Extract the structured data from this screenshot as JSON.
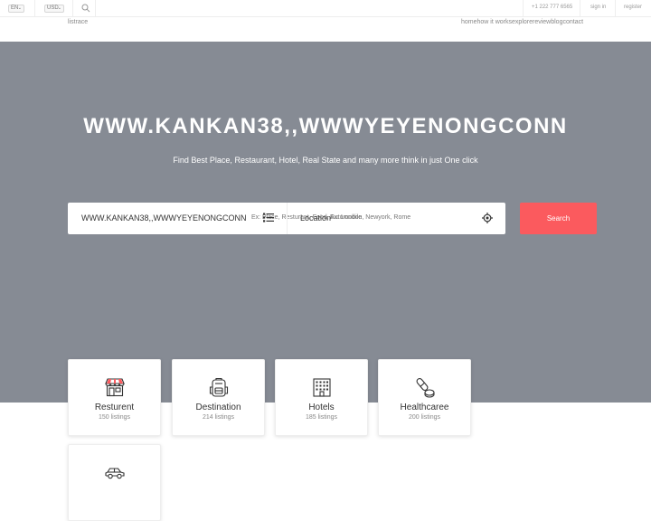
{
  "topbar": {
    "language": "EN",
    "currency": "USD",
    "phone": "+1 222 777 6565",
    "signin": "sign in",
    "register": "register"
  },
  "header": {
    "logo": "listrace",
    "nav": [
      "home",
      "how it works",
      "explore",
      "review",
      "blog",
      "contact"
    ]
  },
  "hero": {
    "title": "WWW.KANKAN38,,WWWYEYENONGCONN",
    "subtitle": "Find Best Place, Restaurant, Hotel, Real State and many more think in just One click"
  },
  "search": {
    "keyword_value": "WWW.KANKAN38,,WWWYEYENONGCONN",
    "keyword_placeholder": "Ex: Place, Resturant, Food, Automobile",
    "location_label": "Location",
    "location_placeholder": "Ex: London, Newyork, Rome",
    "button": "Search"
  },
  "categories": [
    {
      "name": "Resturent",
      "count": "150 listings",
      "icon": "storefront-icon"
    },
    {
      "name": "Destination",
      "count": "214 listings",
      "icon": "backpack-icon"
    },
    {
      "name": "Hotels",
      "count": "185 listings",
      "icon": "building-icon"
    },
    {
      "name": "Healthcaree",
      "count": "200 listings",
      "icon": "pill-icon"
    },
    {
      "name": "",
      "count": "",
      "icon": "car-icon"
    }
  ]
}
